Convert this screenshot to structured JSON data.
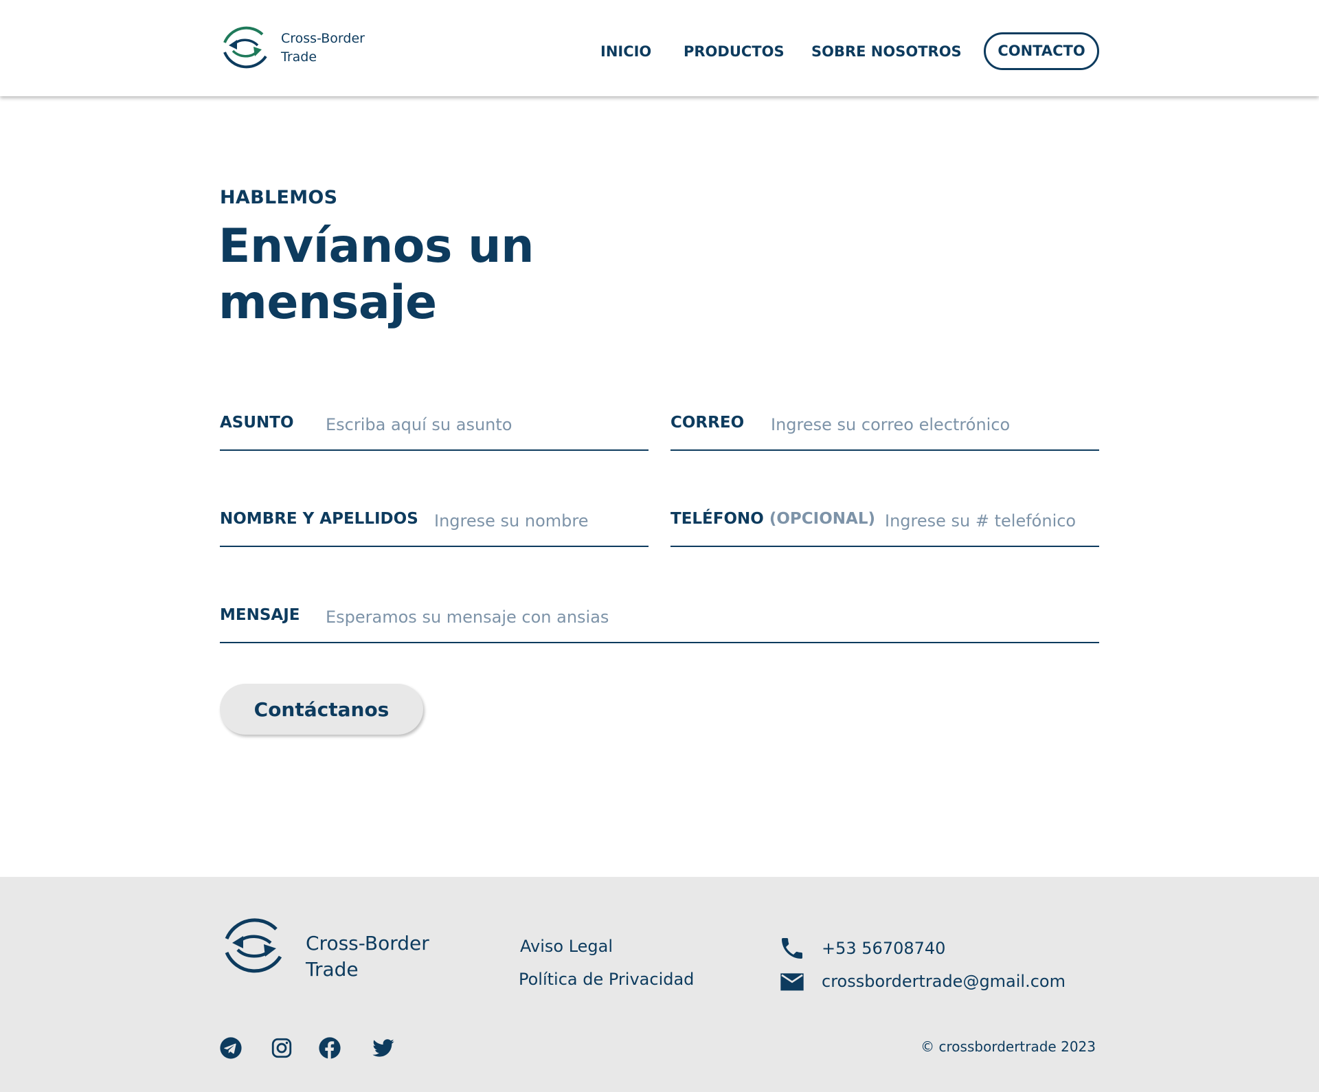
{
  "brand": {
    "name_line1": "Cross-Border",
    "name_line2": "Trade",
    "primary_color": "#0d3b5e",
    "accent_color": "#1f7a5a"
  },
  "nav": {
    "inicio": "INICIO",
    "productos": "PRODUCTOS",
    "sobre": "SOBRE NOSOTROS",
    "contacto": "CONTACTO"
  },
  "hero": {
    "eyebrow": "HABLEMOS",
    "title_line1": "Envíanos un",
    "title_line2": "mensaje"
  },
  "form": {
    "asunto": {
      "label": "ASUNTO",
      "placeholder": "Escriba aquí su asunto",
      "value": ""
    },
    "correo": {
      "label": "CORREO",
      "placeholder": "Ingrese su correo electrónico",
      "value": ""
    },
    "nombre": {
      "label": "NOMBRE Y APELLIDOS",
      "placeholder": "Ingrese su nombre",
      "value": ""
    },
    "telefono": {
      "label": "TELÉFONO",
      "optional": "(OPCIONAL)",
      "placeholder": "Ingrese su # telefónico",
      "value": ""
    },
    "mensaje": {
      "label": "MENSAJE",
      "placeholder": "Esperamos su mensaje con ansias",
      "value": ""
    },
    "submit_label": "Contáctanos"
  },
  "footer": {
    "aviso_legal": "Aviso Legal",
    "privacidad": "Política de Privacidad",
    "phone": "+53 56708740",
    "email": "crossbordertrade@gmail.com",
    "copyright": "© crossbordertrade 2023",
    "social_icons": [
      "telegram-icon",
      "instagram-icon",
      "facebook-icon",
      "twitter-icon"
    ]
  }
}
